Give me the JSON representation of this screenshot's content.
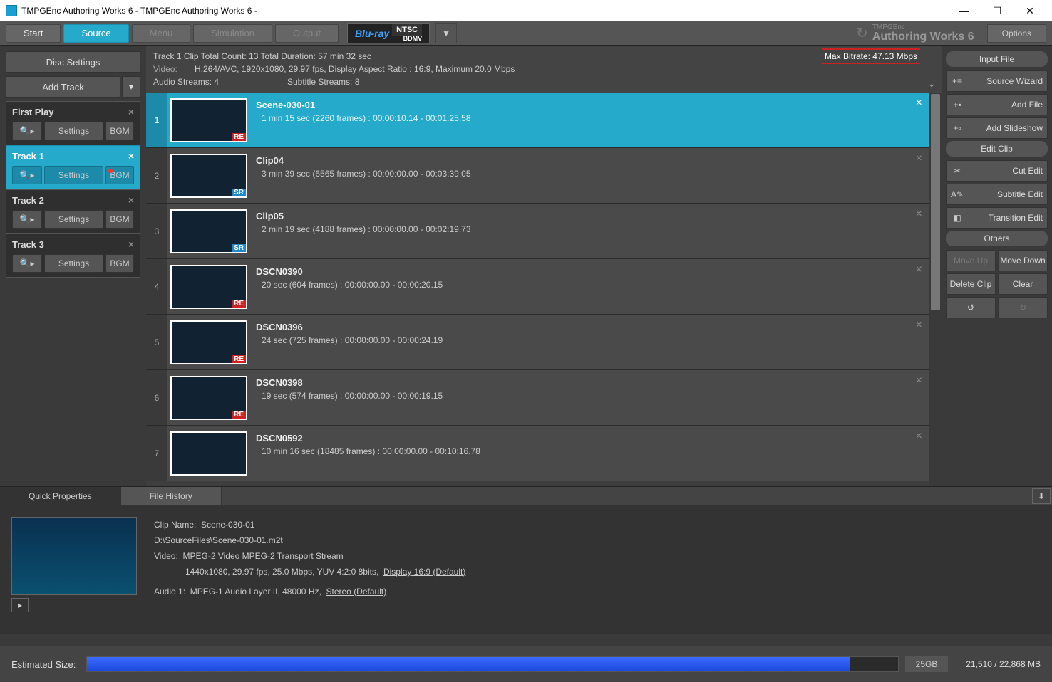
{
  "titlebar": {
    "title": "TMPGEnc Authoring Works 6 - TMPGEnc Authoring Works 6 -"
  },
  "nav": {
    "start": "Start",
    "source": "Source",
    "menu": "Menu",
    "simulation": "Simulation",
    "output": "Output",
    "disc_fmt": "Blu-ray",
    "disc_sub": "BDMV",
    "region": "NTSC",
    "brand_small": "TMPGEnc",
    "brand": "Authoring Works 6",
    "options": "Options"
  },
  "left": {
    "disc_settings": "Disc Settings",
    "add_track": "Add Track",
    "tracks": [
      {
        "name": "First Play",
        "settings": "Settings",
        "bgm": "BGM",
        "has_bgm_btn": true,
        "rec": false
      },
      {
        "name": "Track 1",
        "settings": "Settings",
        "bgm": "BGM",
        "has_bgm_btn": true,
        "rec": true,
        "selected": true
      },
      {
        "name": "Track 2",
        "settings": "Settings",
        "bgm": "BGM",
        "has_bgm_btn": true,
        "rec": false
      },
      {
        "name": "Track 3",
        "settings": "Settings",
        "bgm": "BGM",
        "has_bgm_btn": true,
        "rec": false
      }
    ]
  },
  "header": {
    "track_line": "Track 1  Clip Total Count:  13    Total Duration:  57 min 32 sec",
    "video_label": "Video:",
    "video_line": "H.264/AVC,  1920x1080,  29.97 fps,   Display Aspect Ratio : 16:9,  Maximum 20.0 Mbps",
    "audio_line": "Audio Streams: 4",
    "subtitle_line": "Subtitle Streams: 8",
    "max_bitrate": "Max Bitrate: 47.13 Mbps"
  },
  "clips": [
    {
      "idx": "1",
      "name": "Scene-030-01",
      "dur": "1 min 15 sec (2260 frames) : 00:00:10.14 - 00:01:25.58",
      "badge": "RE",
      "th": "th-blue",
      "selected": true
    },
    {
      "idx": "2",
      "name": "Clip04",
      "dur": "3 min 39 sec (6565 frames) : 00:00:00.00 - 00:03:39.05",
      "badge": "SR",
      "th": "th-dark"
    },
    {
      "idx": "3",
      "name": "Clip05",
      "dur": "2 min 19 sec (4188 frames) : 00:00:00.00 - 00:02:19.73",
      "badge": "SR",
      "th": "th-blue"
    },
    {
      "idx": "4",
      "name": "DSCN0390",
      "dur": "20 sec (604 frames) : 00:00:00.00 - 00:00:20.15",
      "badge": "RE",
      "th": "th-rock"
    },
    {
      "idx": "5",
      "name": "DSCN0396",
      "dur": "24 sec (725 frames) : 00:00:00.00 - 00:00:24.19",
      "badge": "RE",
      "th": "th-rock2"
    },
    {
      "idx": "6",
      "name": "DSCN0398",
      "dur": "19 sec (574 frames) : 00:00:00.00 - 00:00:19.15",
      "badge": "RE",
      "th": "th-rock3"
    },
    {
      "idx": "7",
      "name": "DSCN0592",
      "dur": "10 min 16 sec (18485 frames) : 00:00:00.00 - 00:10:16.78",
      "badge": "",
      "th": "th-gray"
    }
  ],
  "right": {
    "input_file": "Input File",
    "source_wizard": "Source Wizard",
    "add_file": "Add File",
    "add_slideshow": "Add Slideshow",
    "edit_clip": "Edit Clip",
    "cut_edit": "Cut Edit",
    "subtitle_edit": "Subtitle Edit",
    "transition_edit": "Transition Edit",
    "others": "Others",
    "move_up": "Move Up",
    "move_down": "Move Down",
    "delete_clip": "Delete Clip",
    "clear": "Clear"
  },
  "props": {
    "tab1": "Quick Properties",
    "tab2": "File History",
    "clip_name_label": "Clip Name:",
    "clip_name": "Scene-030-01",
    "path": "D:\\SourceFiles\\Scene-030-01.m2t",
    "video_label": "Video:",
    "video": "MPEG-2 Video  MPEG-2 Transport Stream",
    "video2": "1440x1080,  29.97 fps,  25.0 Mbps,  YUV 4:2:0 8bits,",
    "video_link": "Display 16:9 (Default)",
    "audio_label": "Audio  1:",
    "audio": "MPEG-1 Audio Layer II, 48000  Hz,",
    "audio_link": "Stereo (Default)"
  },
  "footer": {
    "label": "Estimated Size:",
    "capacity": "25GB",
    "size": "21,510 / 22,868 MB"
  }
}
